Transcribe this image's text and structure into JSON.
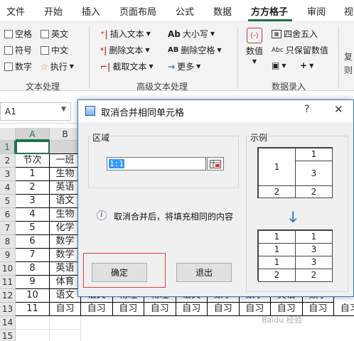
{
  "tabs": [
    "文件",
    "开始",
    "插入",
    "页面布局",
    "公式",
    "数据",
    "方方格子",
    "审阅",
    "视"
  ],
  "active_tab": "方方格子",
  "ribbon": {
    "text_processing": {
      "checkboxes": [
        "空格",
        "英文",
        "符号",
        "中文",
        "数字"
      ],
      "execute_label": "执行",
      "group_label": "文本处理"
    },
    "advanced_text": {
      "buttons": [
        "插入文本",
        "删除文本",
        "截取文本",
        "大小写",
        "删除空格",
        "更多"
      ],
      "icons": {
        "case": "Ab",
        "delete_space": "AB"
      },
      "group_label": "高级文本处理"
    },
    "numeric_entry": {
      "numeric_label": "数值",
      "round_label": "四舍五入",
      "keep_numeric_label": "只保留数值",
      "keep_numeric_icon": "Abc",
      "plus": "+",
      "group_label": "数据录入"
    },
    "extra": [
      "复",
      "则"
    ]
  },
  "name_box": "A1",
  "columns": [
    "A",
    "B"
  ],
  "rows": [
    "1",
    "2",
    "3",
    "4",
    "5",
    "6",
    "7",
    "8",
    "9",
    "10",
    "11",
    "12",
    "13",
    "14",
    "15"
  ],
  "sheet": {
    "header": [
      "节次",
      "一班"
    ],
    "numbers": [
      "1",
      "2",
      "3",
      "4",
      "5",
      "6",
      "7",
      "8",
      "9",
      "10",
      "11"
    ],
    "classB": [
      "生物",
      "英语",
      "语文",
      "生物",
      "化学",
      "数学",
      "数学",
      "英语",
      "体育",
      "语文",
      "自习"
    ],
    "row12_fragments": [
      "语文",
      "物理",
      "物理",
      "语文",
      "数学",
      "数学",
      "英语",
      "数学"
    ],
    "row13": [
      "自习",
      "自习",
      "自习",
      "自习",
      "自习",
      "自习",
      "自习",
      "自习",
      "自习"
    ]
  },
  "dialog": {
    "title": "取消合并相同单元格",
    "help": "?",
    "close": "✕",
    "area_label": "区域",
    "range_value": "1:1",
    "example_label": "示例",
    "info": "取消合并后，将填充相同的内容",
    "ok": "确定",
    "exit": "退出",
    "example_before": [
      "1",
      "1",
      "3",
      "2",
      "2"
    ],
    "example_after": [
      "1",
      "1",
      "1",
      "3",
      "1",
      "3",
      "2",
      "2"
    ]
  },
  "watermark": "Baidu 经验"
}
